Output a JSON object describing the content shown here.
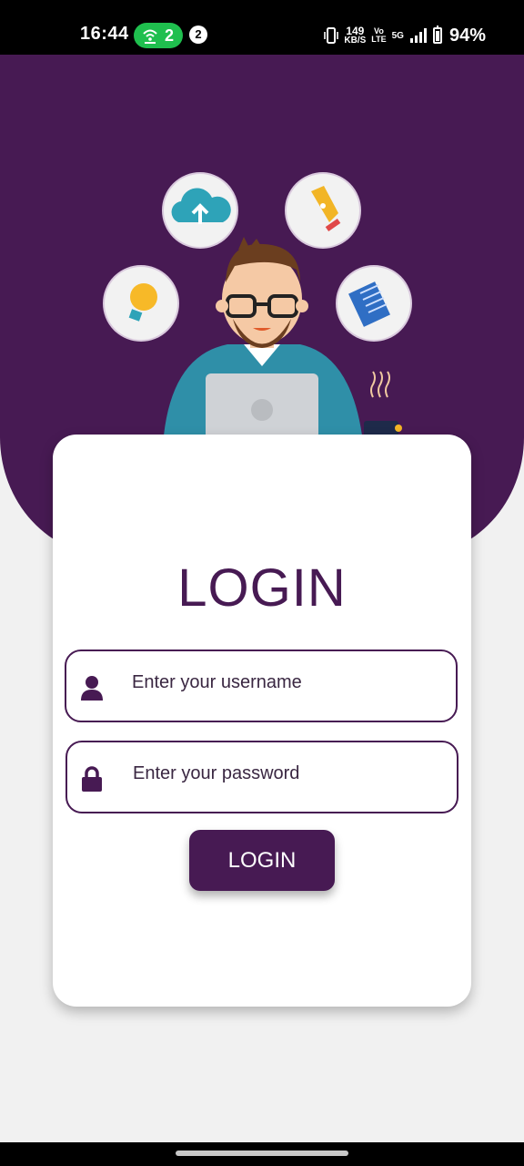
{
  "status_bar": {
    "time": "16:44",
    "hotspot_count": "2",
    "notification_count": "2",
    "speed_value": "149",
    "speed_unit": "KB/S",
    "volte_top": "Vo",
    "volte_bottom": "LTE",
    "network": "5G",
    "battery": "94%"
  },
  "hero": {
    "background_color": "#471a53",
    "icons": [
      "cloud-upload-icon",
      "pen-nib-icon",
      "lightbulb-icon",
      "document-icon"
    ]
  },
  "login": {
    "title": "LOGIN",
    "username_placeholder": "Enter your username",
    "password_placeholder": "Enter your password",
    "button_label": "LOGIN"
  },
  "colors": {
    "primary": "#471a53",
    "background": "#f1f1f1",
    "card": "#ffffff"
  }
}
